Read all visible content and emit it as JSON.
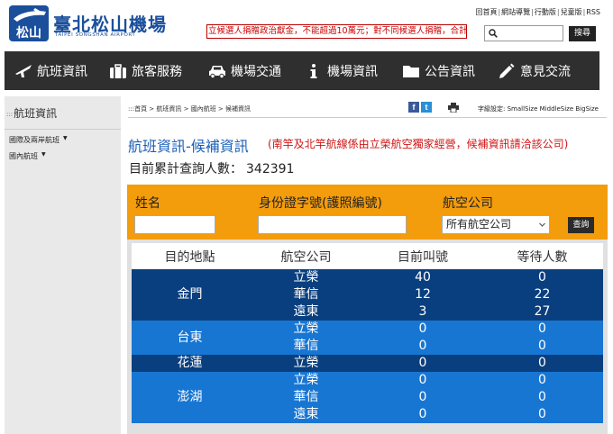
{
  "header": {
    "logo_title": "臺北松山機場",
    "logo_sub": "TAIPEI SONGSHAN AIRPORT",
    "marquee_text": "立候選人捐贈政治獻金，不能超過10萬元；對不同候選人捐贈，合計不",
    "top_links": [
      "回首頁",
      "網站導覽",
      "行動版",
      "兒童版",
      "RSS"
    ],
    "search_placeholder": "",
    "search_button": "搜尋"
  },
  "nav": {
    "items": [
      {
        "label": "航班資訊",
        "icon": "airplane-icon"
      },
      {
        "label": "旅客服務",
        "icon": "suitcase-icon"
      },
      {
        "label": "機場交通",
        "icon": "car-icon"
      },
      {
        "label": "機場資訊",
        "icon": "info-icon"
      },
      {
        "label": "公告資訊",
        "icon": "folder-icon"
      },
      {
        "label": "意見交流",
        "icon": "pencil-icon"
      }
    ]
  },
  "sidebar": {
    "title": "航班資訊",
    "items": [
      {
        "label": "國際及兩岸航班"
      },
      {
        "label": "國內航班"
      }
    ]
  },
  "breadcrumb": ":::首頁 > 航班資訊 > 國內航班 > 候補資訊",
  "fontsize": {
    "label": "字級設定:",
    "options": [
      "SmallSize",
      "MiddleSize",
      "BigSize"
    ]
  },
  "page": {
    "title": "航班資訊-候補資訊",
    "note": "(南竿及北竿航線係由立榮航空獨家經營，候補資訊請洽該公司)",
    "query_label": "目前累計查詢人數：",
    "query_count": "342391"
  },
  "form": {
    "name_label": "姓名",
    "id_label": "身份證字號(護照編號)",
    "airline_label": "航空公司",
    "name_value": "",
    "id_value": "",
    "airline_selected": "所有航空公司",
    "query_button": "查詢"
  },
  "table": {
    "headers": [
      "目的地點",
      "航空公司",
      "目前叫號",
      "等待人數"
    ],
    "groups": [
      {
        "destination": "金門",
        "tone": "dark",
        "rows": [
          {
            "airline": "立榮",
            "current": "40",
            "waiting": "0"
          },
          {
            "airline": "華信",
            "current": "12",
            "waiting": "22"
          },
          {
            "airline": "遠東",
            "current": "3",
            "waiting": "27"
          }
        ]
      },
      {
        "destination": "台東",
        "tone": "light",
        "rows": [
          {
            "airline": "立榮",
            "current": "0",
            "waiting": "0"
          },
          {
            "airline": "華信",
            "current": "0",
            "waiting": "0"
          }
        ]
      },
      {
        "destination": "花蓮",
        "tone": "dark",
        "rows": [
          {
            "airline": "立榮",
            "current": "0",
            "waiting": "0"
          }
        ]
      },
      {
        "destination": "澎湖",
        "tone": "light",
        "rows": [
          {
            "airline": "立榮",
            "current": "0",
            "waiting": "0"
          },
          {
            "airline": "華信",
            "current": "0",
            "waiting": "0"
          },
          {
            "airline": "遠東",
            "current": "0",
            "waiting": "0"
          }
        ]
      }
    ]
  },
  "colors": {
    "brand_blue": "#1b4f9c",
    "nav_bg": "#2f2f2f",
    "form_orange": "#f39c0c",
    "row_dark": "#0a3f7f",
    "row_light": "#1876d3",
    "title_blue": "#1b5fb8",
    "note_red": "#d01515"
  }
}
